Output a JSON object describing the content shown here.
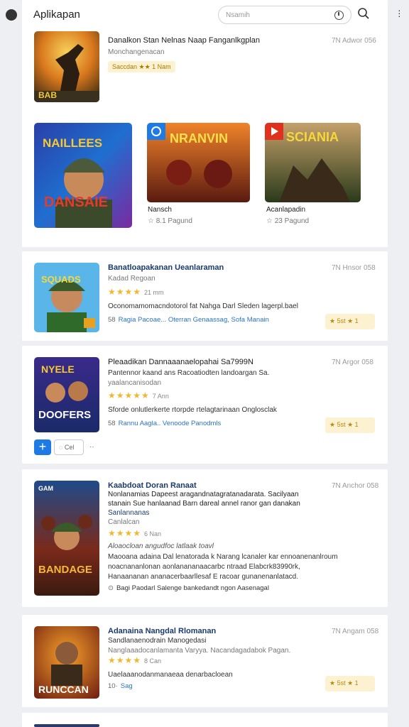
{
  "app": {
    "title": "Aplikapan"
  },
  "search": {
    "placeholder": "Nsamih"
  },
  "colors": {
    "accent": "#1e7be6",
    "star": "#f0b82e",
    "badge_bg": "#fcf2d2",
    "link": "#2a73c7"
  },
  "featured": {
    "main": {
      "title": "Danalkon Stan Nelnas Naap Fanganlkgplan",
      "subtitle": "Monchangenacan",
      "pill": "Saccdan ★★ 1 Nam",
      "date": "7N Adwor 056",
      "art_text": "BAB"
    },
    "cards": [
      {
        "art_text": "NAILLEES",
        "art_text2": "DANSAIE",
        "label": "",
        "rating": ""
      },
      {
        "art_text": "NRANVIN",
        "label": "Nansch",
        "rating": "☆ 8.1 Pagund"
      },
      {
        "art_text": "SCIANIA",
        "label": "Acanlapadin",
        "rating": "☆ 23 Pagund"
      }
    ]
  },
  "items": [
    {
      "title": "Banatloapakanan Ueanlaraman",
      "subtitle": "Kadad Regoan",
      "stars": "★★★★",
      "count": "21 mm",
      "body": [
        "Oconomamomacndotorol fat Nahga Darl Sleden lagerpl.bael"
      ],
      "tags": "Ragia Pacoae...  Oterran Genaassag,  Sofa Manain",
      "tag_icon": "58",
      "badge": "★ 5st  ★ 1",
      "date": "7N Hnsor 058",
      "art_text": "SQUADS"
    },
    {
      "title": "Pleaadikan Dannaaanaelopahai Sa7999N",
      "subtitle": "Pantennor kaand ans Racoatiodten landoargan Sa.",
      "subtitle2": "yaalancanisodan",
      "stars": "★★★★★",
      "count": "7 Ann",
      "body": [
        "Sforde onlutlerkerte rtorpde rtelagtarinaan Onglosclak"
      ],
      "tags": "Rannu Aagla..  Venoode Panodmls",
      "tag_icon": "58",
      "badge": "★ 5st  ★ 1",
      "date": "7N Argor 058",
      "art_text": "DOOFERS",
      "chat_label": "Cel"
    },
    {
      "title": "Kaabdoat Doran Ranaat",
      "subtitle": "Nonlanamias Dapeest aragandnatagratanadarata. Sacilyaan",
      "subtitle2": "stanain Sue hanlaanad Barn dareal annel ranor gan danakan",
      "link": "Sanlannanas",
      "meta": "Canlalcan",
      "stars": "★★★★",
      "count": "6 Nan",
      "quote": "Aloaocloan angudfoc latlaak toavl",
      "body": [
        "Maooana adaina Dal lenatorada k Narang lcanaler kar ennoanenanlroum",
        "noacnananlonan aonlanananaacarbc ntraad Elabcrk83990rk,",
        "Hanaananan ananacerbaarllesaf E racoar gunanenanlatacd."
      ],
      "tags": "Bagi Paodarl   Salenge bankedandt ngon Aasenagal",
      "tag_icon": "⊙",
      "date": "7N Anchor 058",
      "art_text": "BANDAGE"
    },
    {
      "title": "Adanaina Nangdal Rlomanan",
      "subtitle": "Sandlanaenodrain Manogedasi",
      "subtitle2": "Nanglaaadocanlamanta Varyya. Nacandagadabok Pagan.",
      "stars": "★★★★",
      "count": "8 Can",
      "body": [
        "Uaelaaanodanmanaeaa denarbacloean"
      ],
      "tags": "Sag",
      "tag_icon": "10·",
      "badge": "★ 5st  ★ 1",
      "date": "7N Angam 058",
      "art_text": "RUNCCAN"
    }
  ]
}
